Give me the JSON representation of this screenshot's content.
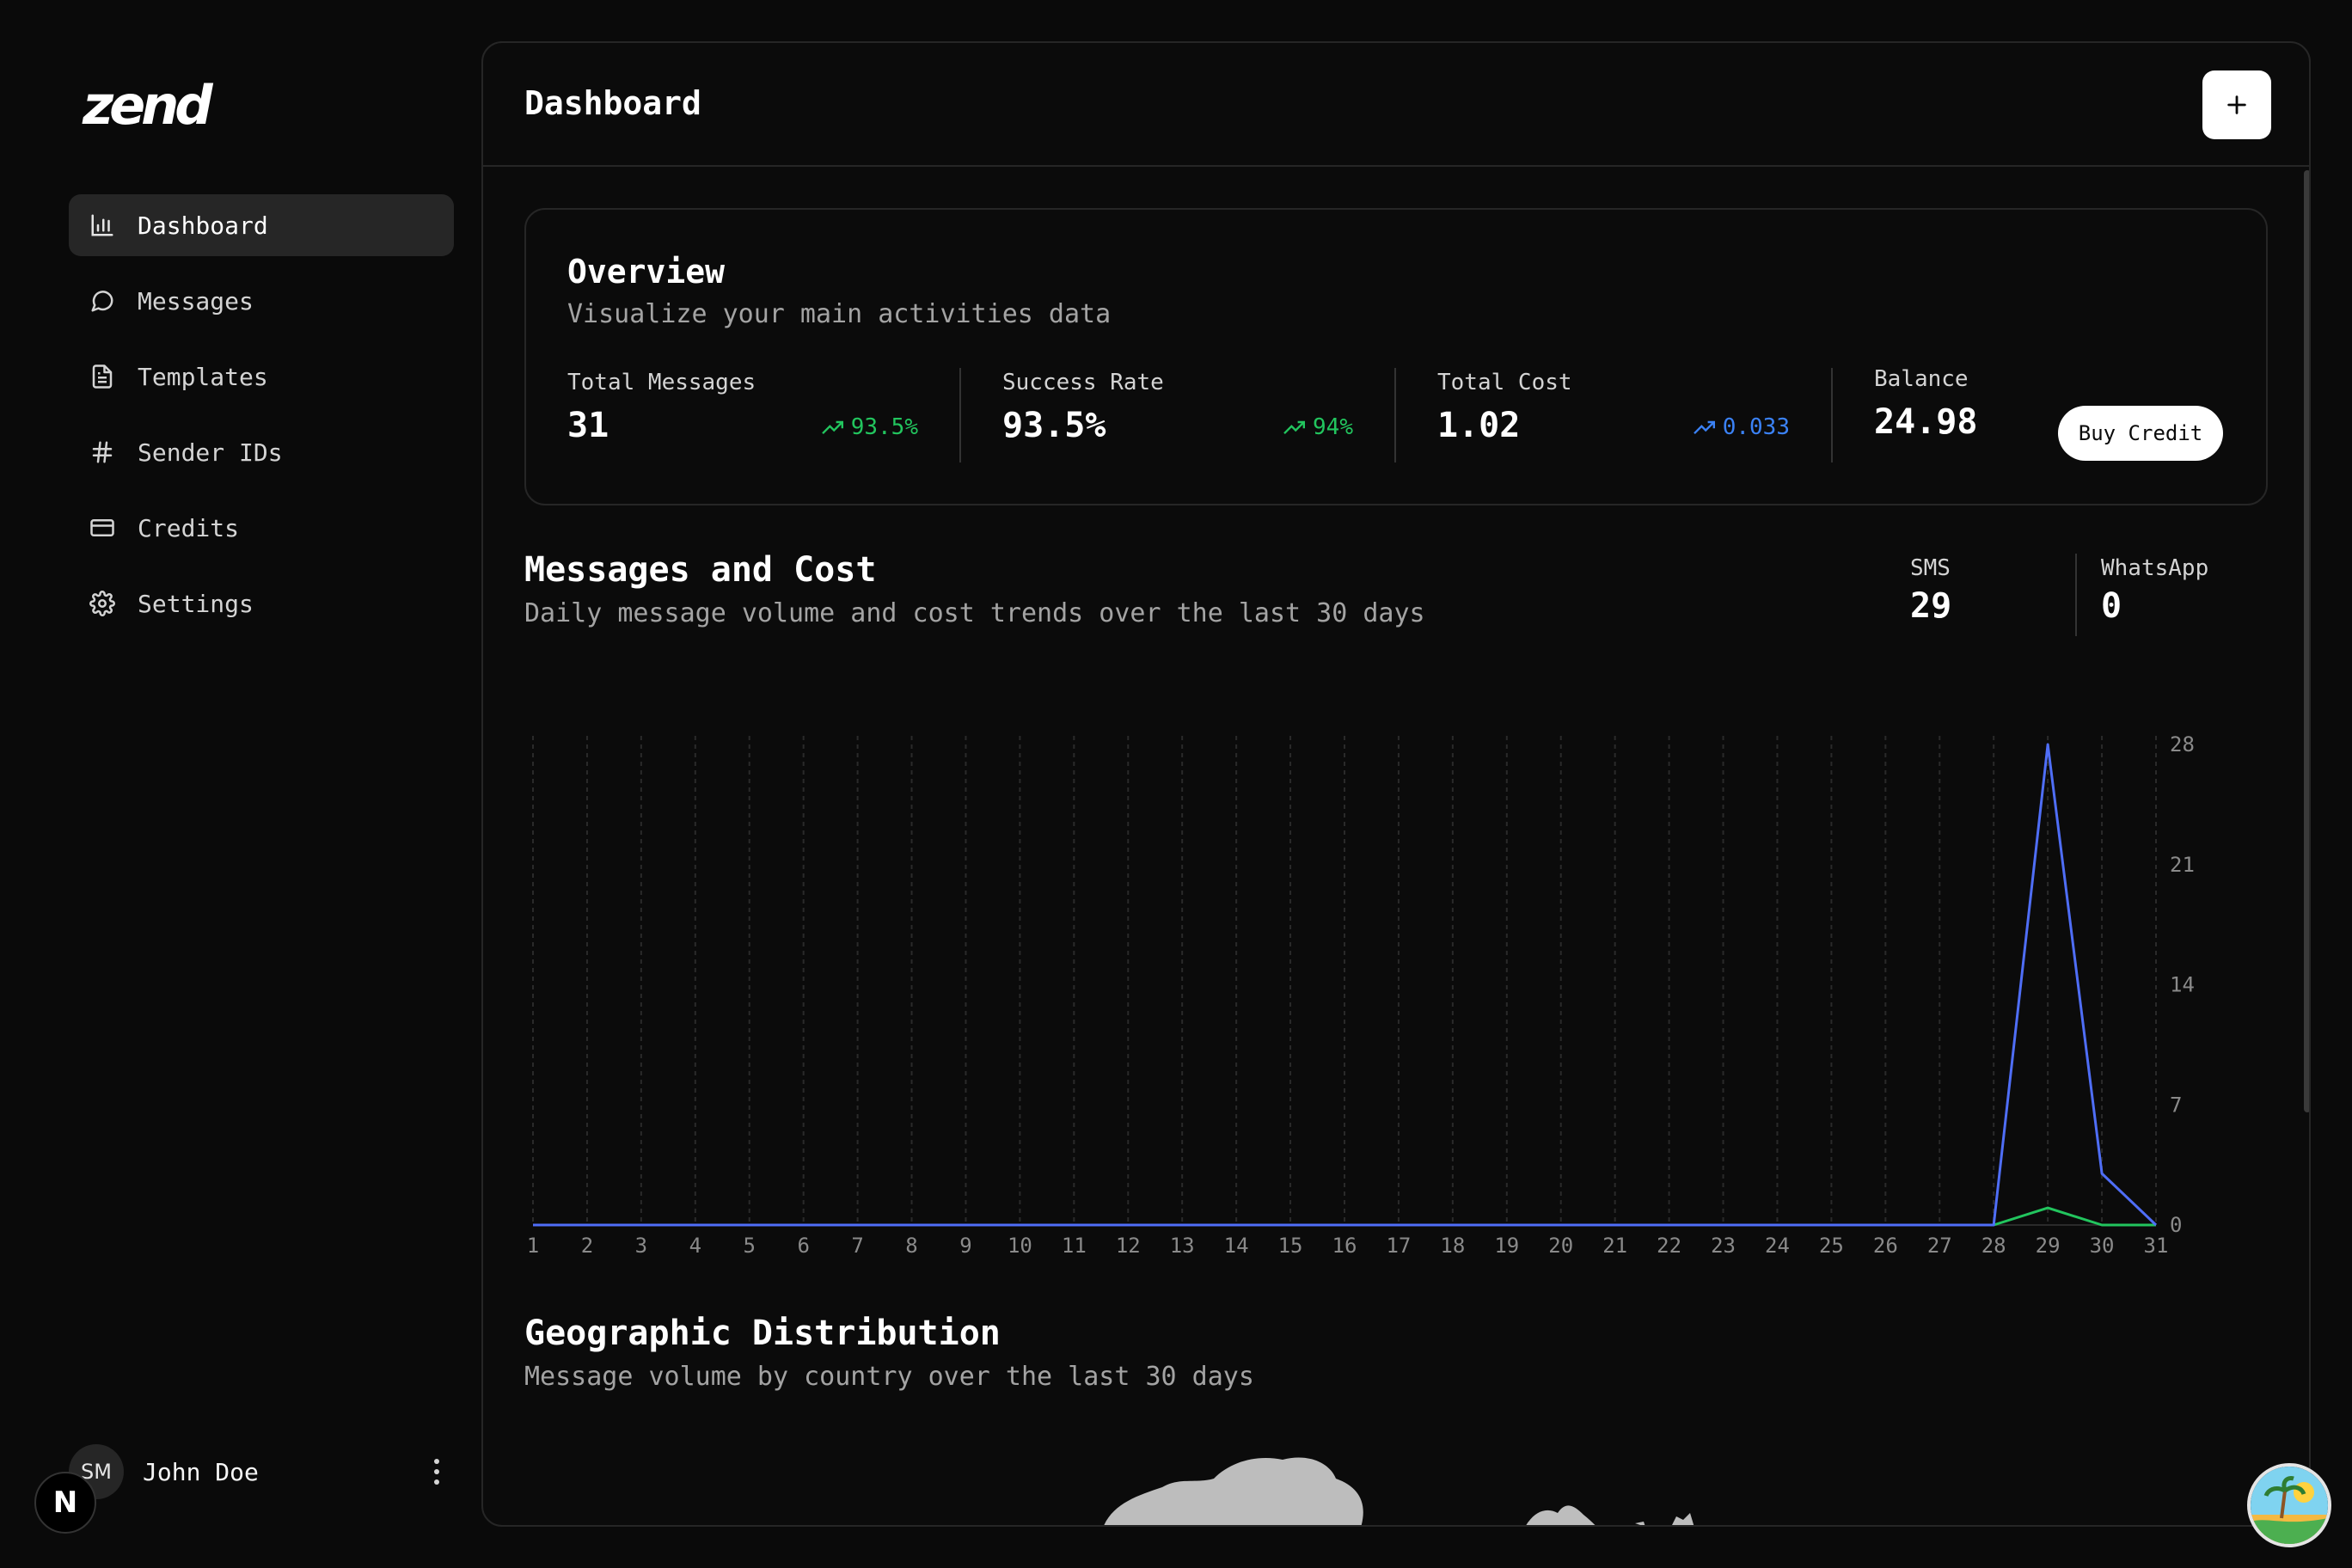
{
  "app": {
    "logo": "zend"
  },
  "sidebar": {
    "items": [
      {
        "label": "Dashboard",
        "icon": "bar-chart-icon",
        "active": true
      },
      {
        "label": "Messages",
        "icon": "message-circle-icon"
      },
      {
        "label": "Templates",
        "icon": "file-text-icon"
      },
      {
        "label": "Sender IDs",
        "icon": "hash-icon"
      },
      {
        "label": "Credits",
        "icon": "credit-card-icon"
      },
      {
        "label": "Settings",
        "icon": "gear-icon"
      }
    ],
    "user": {
      "initials": "SM",
      "name": "John Doe"
    },
    "badge": "N"
  },
  "header": {
    "title": "Dashboard",
    "add_label": "+"
  },
  "overview": {
    "title": "Overview",
    "subtitle": "Visualize your main activities data",
    "stats": [
      {
        "label": "Total Messages",
        "value": "31",
        "trend": "93.5%",
        "trend_color": "#22c55e"
      },
      {
        "label": "Success Rate",
        "value": "93.5%",
        "trend": "94%",
        "trend_color": "#22c55e"
      },
      {
        "label": "Total Cost",
        "value": "1.02",
        "trend": "0.033",
        "trend_color": "#3b82f6"
      },
      {
        "label": "Balance",
        "value": "24.98"
      }
    ],
    "buy_label": "Buy Credit"
  },
  "messages_chart": {
    "title": "Messages and Cost",
    "subtitle": "Daily message volume and cost trends over the last 30 days",
    "legend": [
      {
        "label": "SMS",
        "value": "29"
      },
      {
        "label": "WhatsApp",
        "value": "0"
      }
    ]
  },
  "chart_data": {
    "type": "line",
    "x": [
      1,
      2,
      3,
      4,
      5,
      6,
      7,
      8,
      9,
      10,
      11,
      12,
      13,
      14,
      15,
      16,
      17,
      18,
      19,
      20,
      21,
      22,
      23,
      24,
      25,
      26,
      27,
      28,
      29,
      30,
      31
    ],
    "series": [
      {
        "color": "#4f6ef7",
        "values": [
          0,
          0,
          0,
          0,
          0,
          0,
          0,
          0,
          0,
          0,
          0,
          0,
          0,
          0,
          0,
          0,
          0,
          0,
          0,
          0,
          0,
          0,
          0,
          0,
          0,
          0,
          0,
          0,
          28,
          3,
          0
        ]
      },
      {
        "color": "#22c55e",
        "values": [
          0,
          0,
          0,
          0,
          0,
          0,
          0,
          0,
          0,
          0,
          0,
          0,
          0,
          0,
          0,
          0,
          0,
          0,
          0,
          0,
          0,
          0,
          0,
          0,
          0,
          0,
          0,
          0,
          1,
          0,
          0
        ]
      }
    ],
    "yticks": [
      0,
      7,
      14,
      21,
      28
    ],
    "ylim": [
      0,
      28
    ],
    "grid": "vertical-dashed",
    "y_axis_side": "right"
  },
  "geo": {
    "title": "Geographic Distribution",
    "subtitle": "Message volume by country over the last 30 days"
  }
}
